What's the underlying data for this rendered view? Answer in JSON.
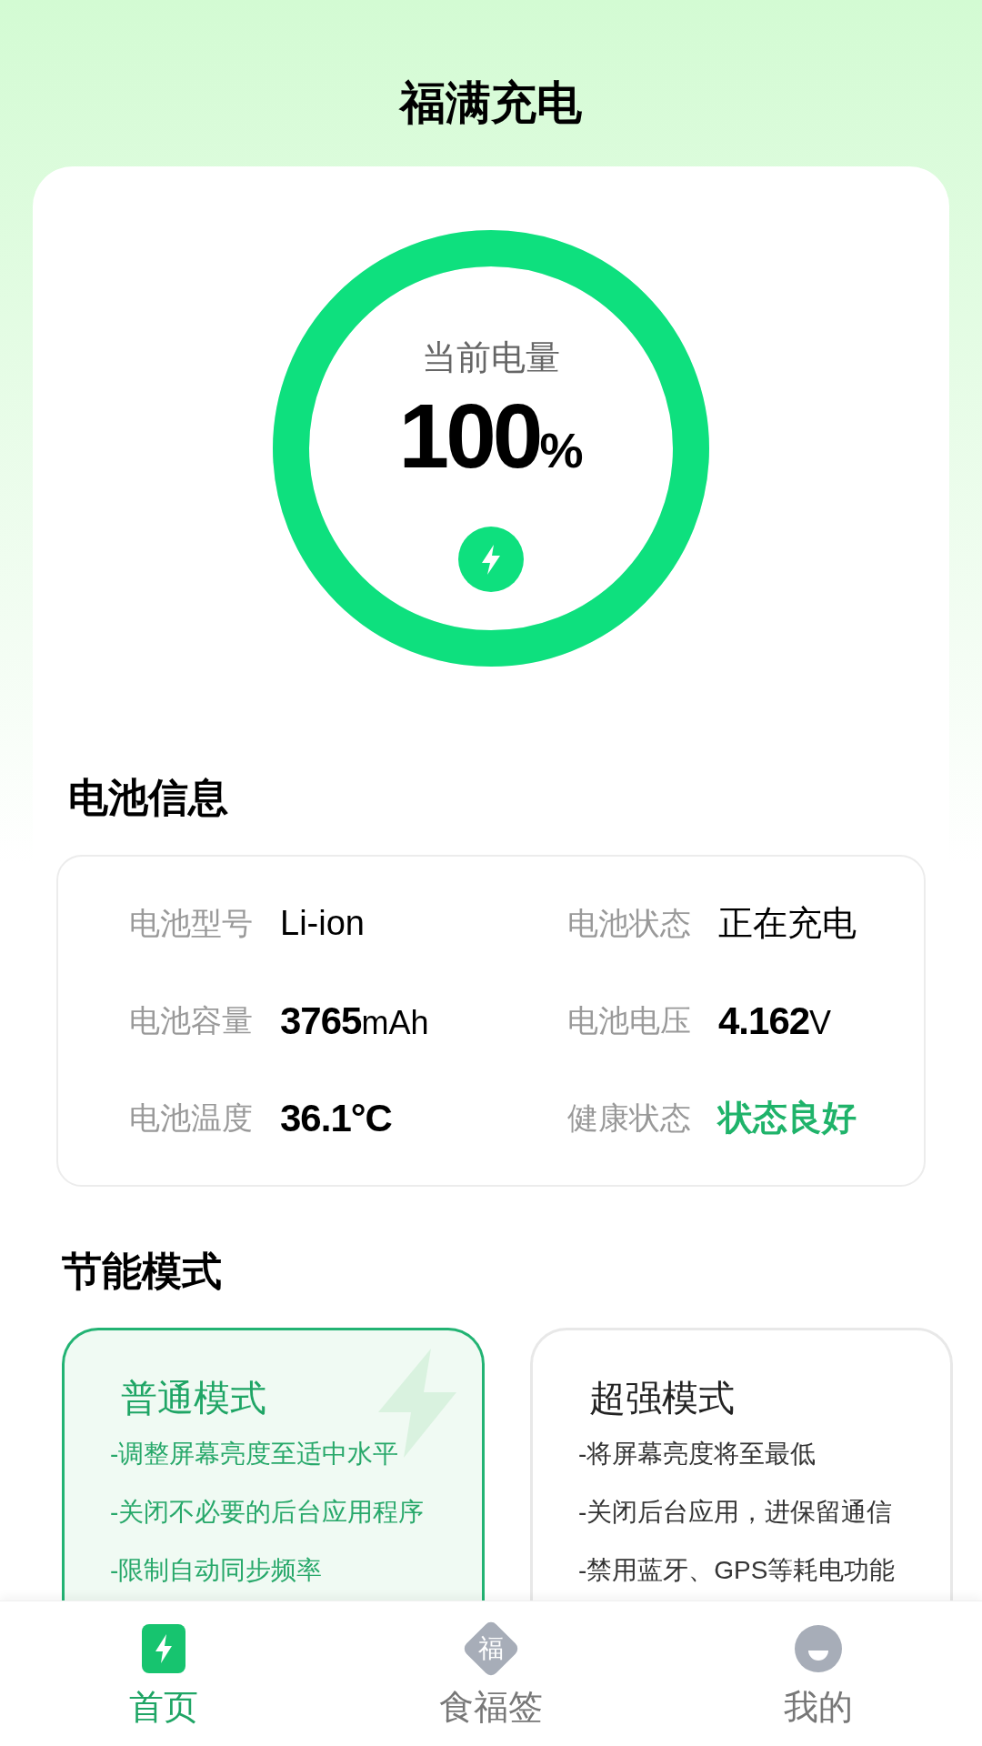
{
  "header": {
    "title": "福满充电"
  },
  "battery": {
    "label": "当前电量",
    "value": "100",
    "unit": "%",
    "level": 1,
    "charging": true
  },
  "info": {
    "title": "电池信息",
    "items": [
      {
        "label": "电池型号",
        "value": "Li-ion",
        "bold": false,
        "highlight": false
      },
      {
        "label": "电池状态",
        "value": "正在充电",
        "bold": false,
        "highlight": false
      },
      {
        "label": "电池容量",
        "value": "3765",
        "unit": "mAh",
        "bold": true,
        "highlight": false
      },
      {
        "label": "电池电压",
        "value": "4.162",
        "unit": "V",
        "bold": true,
        "highlight": false
      },
      {
        "label": "电池温度",
        "value": "36.1°C",
        "bold": true,
        "highlight": false
      },
      {
        "label": "健康状态",
        "value": "状态良好",
        "bold": false,
        "highlight": true
      }
    ]
  },
  "modes": {
    "title": "节能模式",
    "items": [
      {
        "title": "普通模式",
        "selected": true,
        "lines": [
          "-调整屏幕亮度至适中水平",
          "-关闭不必要的后台应用程序",
          "-限制自动同步频率"
        ]
      },
      {
        "title": "超强模式",
        "selected": false,
        "lines": [
          "-将屏幕亮度将至最低",
          "-关闭后台应用，进保留通信",
          "-禁用蓝牙、GPS等耗电功能"
        ]
      }
    ]
  },
  "nav": [
    {
      "label": "首页",
      "kind": "bolt",
      "selected": true
    },
    {
      "label": "食福签",
      "kind": "charm",
      "icon_text": "福",
      "selected": false
    },
    {
      "label": "我的",
      "kind": "profile",
      "selected": false
    }
  ]
}
